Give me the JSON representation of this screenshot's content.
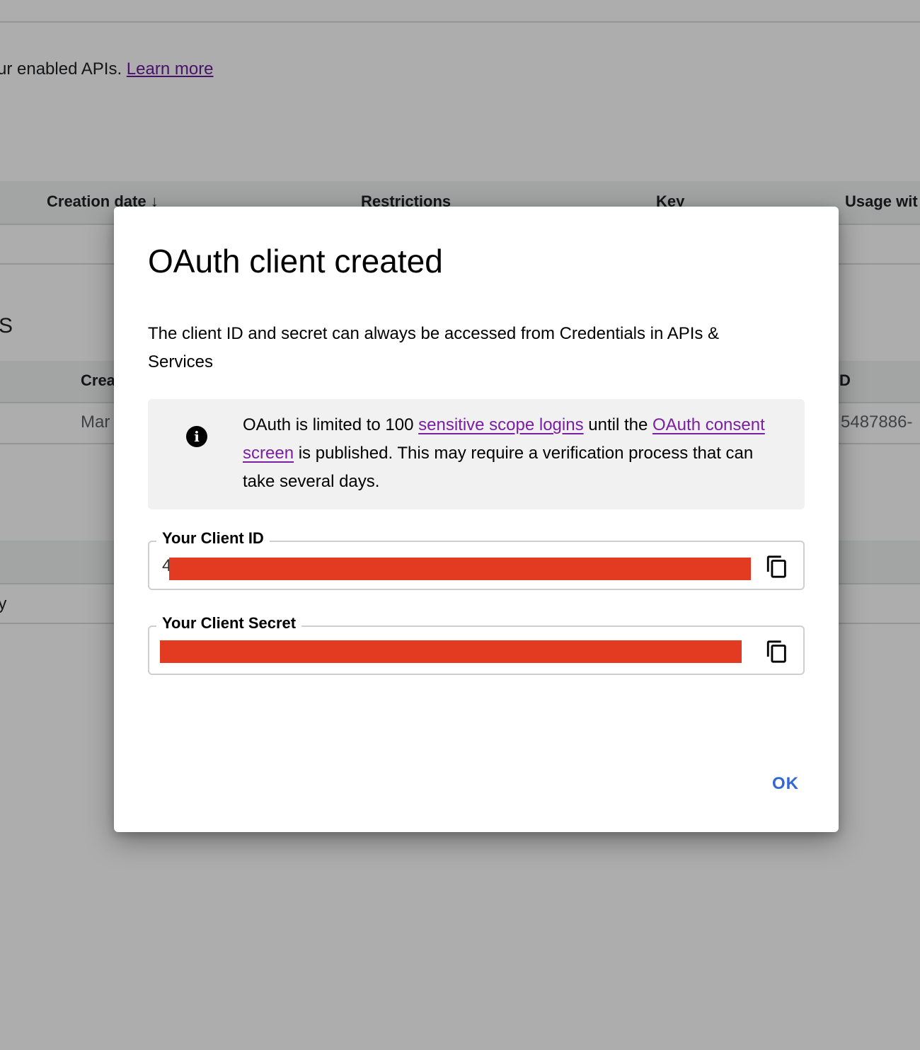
{
  "background": {
    "intro_text": "ur enabled APIs.",
    "learn_more": "Learn more",
    "api_keys_table": {
      "headers": [
        "Creation date",
        "Restrictions",
        "Key",
        "Usage wit"
      ]
    },
    "section_letter": "S",
    "oauth_table": {
      "header_partial": "Crea",
      "header_right": "D",
      "row_date_partial": "Mar",
      "row_id_partial": "5487886-"
    },
    "partial_row_text": "ly"
  },
  "dialog": {
    "title": "OAuth client created",
    "description": "The client ID and secret can always be accessed from Credentials in APIs & Services",
    "notice": {
      "icon": "info-icon",
      "part1": "OAuth is limited to 100 ",
      "link1": "sensitive scope logins",
      "part2": " until the ",
      "link2": "OAuth consent screen",
      "part3": " is published. This may require a verification process that can take several days."
    },
    "client_id": {
      "label": "Your Client ID",
      "value_visible": "4",
      "copy_icon": "copy-icon"
    },
    "client_secret": {
      "label": "Your Client Secret",
      "value_visible": "",
      "copy_icon": "copy-icon"
    },
    "ok_label": "OK"
  },
  "colors": {
    "link": "#7b1fa2",
    "primary_button": "#3367d6",
    "redaction": "#e33b22"
  }
}
